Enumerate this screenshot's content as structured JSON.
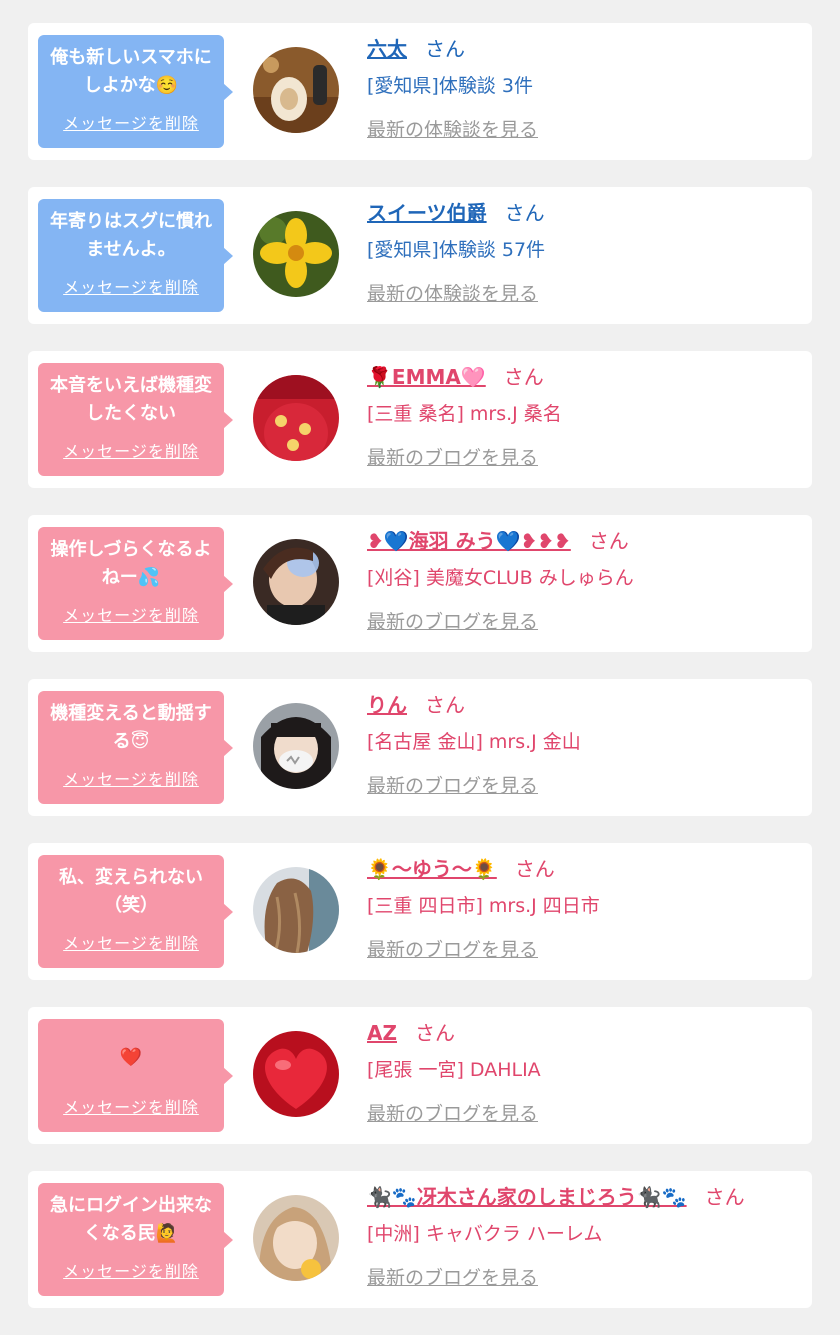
{
  "common": {
    "delete_label": "メッセージを削除",
    "san": "さん",
    "review_link": "最新の体験談を見る",
    "blog_link": "最新のブログを見る"
  },
  "items": [
    {
      "type": "review",
      "color": "blue",
      "message": "俺も新しいスマホにしよかな☺️",
      "name": "六太",
      "shop": "[愛知県]体験談 3件",
      "avatar": "food-photo"
    },
    {
      "type": "review",
      "color": "blue",
      "message": "年寄りはスグに慣れませんよ。",
      "name": "スイーツ伯爵",
      "shop": "[愛知県]体験談 57件",
      "avatar": "yellow-flower"
    },
    {
      "type": "blog",
      "color": "pink",
      "message": "本音をいえば機種変したくない",
      "name": "🌹EMMA🩷",
      "shop": "[三重 桑名] mrs.J 桑名",
      "avatar": "red-shirt"
    },
    {
      "type": "blog",
      "color": "pink",
      "message": "操作しづらくなるよねー💦",
      "name": "❥💙海羽 みう💙❥❥❥",
      "shop": "[刈谷] 美魔女CLUB みしゅらん",
      "avatar": "selfie"
    },
    {
      "type": "blog",
      "color": "pink",
      "message": "機種変えると動揺する😇",
      "name": "りん",
      "shop": "[名古屋 金山] mrs.J 金山",
      "avatar": "mask-girl"
    },
    {
      "type": "blog",
      "color": "pink",
      "message": "私、変えられない（笑）",
      "name": "🌻〜ゆう〜🌻",
      "shop": "[三重 四日市] mrs.J 四日市",
      "avatar": "long-hair"
    },
    {
      "type": "blog",
      "color": "pink",
      "message": "❤️",
      "name": "AZ",
      "shop": "[尾張 一宮] DAHLIA",
      "avatar": "red-heart"
    },
    {
      "type": "blog",
      "color": "pink",
      "message": "急にログイン出来なくなる民🙋",
      "name": "🐈‍⬛🐾冴木さん家のしまじろう🐈‍⬛🐾",
      "shop": "[中洲] キャバクラ ハーレム",
      "avatar": "blonde-girl"
    }
  ],
  "colors": {
    "blue_bubble": "#84b5f3",
    "pink_bubble": "#f797a8",
    "blue_text": "#1f66b8",
    "pink_text": "#e0466c",
    "link_gray": "#9a9a9a"
  }
}
